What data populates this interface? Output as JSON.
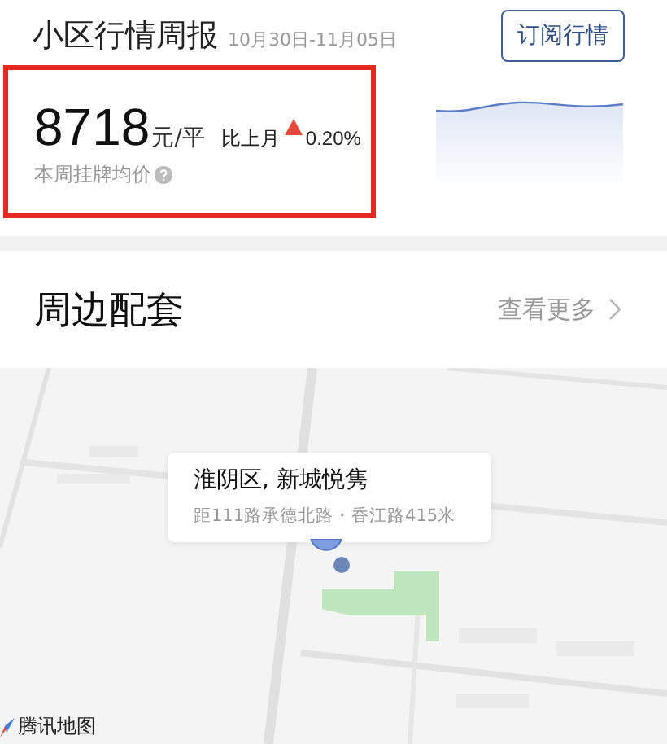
{
  "report": {
    "title": "小区行情周报",
    "date_range": "10月30日-11月05日",
    "subscribe_button": "订阅行情",
    "price": "8718",
    "unit": "元/平",
    "compare_label": "比上月",
    "increase": true,
    "change": "0.20%",
    "caption": "本周挂牌均价"
  },
  "nearby": {
    "title": "周边配套",
    "more_link": "查看更多"
  },
  "map": {
    "popup_title": "淮阴区, 新城悦隽",
    "popup_detail": "距111路承德北路・香江路415米",
    "provider": "腾讯地图"
  }
}
